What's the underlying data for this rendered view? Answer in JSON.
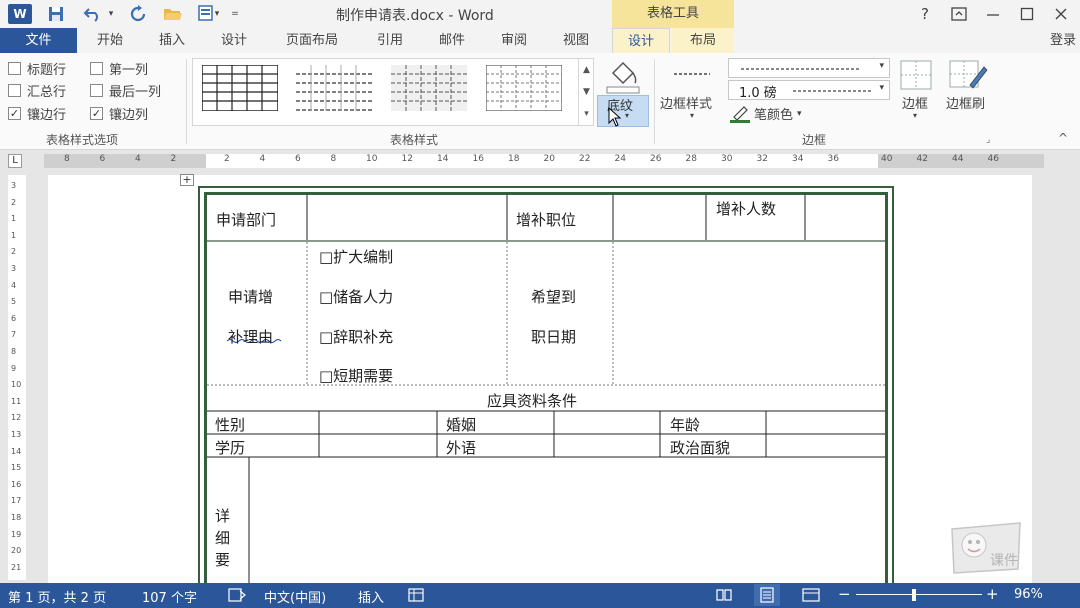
{
  "titlebar": {
    "app_icon": "W",
    "title": "制作申请表.docx - Word",
    "tools_header": "表格工具",
    "help": "?",
    "icons": [
      "word-icon",
      "save-icon",
      "undo-icon",
      "redo-icon",
      "open-folder-icon",
      "print-preview-icon",
      "customize-icon",
      "help-icon",
      "ribbon-display-icon",
      "minimize-icon",
      "maximize-icon",
      "close-icon"
    ]
  },
  "tabs": {
    "file": "文件",
    "items": [
      "开始",
      "插入",
      "设计",
      "页面布局",
      "引用",
      "邮件",
      "审阅",
      "视图"
    ],
    "tools_design": "设计",
    "tools_layout": "布局",
    "login": "登录"
  },
  "ribbon": {
    "options": {
      "header_row": "标题行",
      "first_column": "第一列",
      "total_row": "汇总行",
      "last_column": "最后一列",
      "banded_rows": "镶边行",
      "banded_columns": "镶边列",
      "checked": {
        "header_row": false,
        "first_column": false,
        "total_row": false,
        "last_column": false,
        "banded_rows": true,
        "banded_columns": true
      },
      "group_label": "表格样式选项"
    },
    "styles": {
      "group_label": "表格样式"
    },
    "shading": {
      "label": "底纹"
    },
    "borders": {
      "border_styles": "边框样式",
      "weight": "1.0 磅",
      "pen_color": "笔颜色",
      "borders": "边框",
      "border_painter": "边框刷",
      "group_label": "边框"
    }
  },
  "ruler": {
    "corner": "L",
    "ticks": [
      "8",
      "6",
      "4",
      "2",
      "2",
      "4",
      "6",
      "8",
      "10",
      "12",
      "14",
      "16",
      "18",
      "20",
      "22",
      "24",
      "26",
      "28",
      "30",
      "32",
      "34",
      "36",
      "40",
      "42",
      "44",
      "46"
    ],
    "vticks": [
      "3",
      "2",
      "1",
      "1",
      "2",
      "3",
      "4",
      "5",
      "6",
      "7",
      "8",
      "9",
      "10",
      "11",
      "12",
      "13",
      "14",
      "15",
      "16",
      "17",
      "18",
      "19",
      "20",
      "21"
    ]
  },
  "form": {
    "dept": "申请部门",
    "position": "增补职位",
    "headcount": "增补人数",
    "reason_1": "申请增",
    "reason_2": "补理由",
    "options": [
      "□扩大编制",
      "□储备人力",
      "□辞职补充",
      "□短期需要"
    ],
    "date_1": "希望到",
    "date_2": "职日期",
    "requirements": "应具资料条件",
    "gender": "性别",
    "marriage": "婚姻",
    "age": "年龄",
    "education": "学历",
    "language": "外语",
    "political": "政治面貌",
    "detail": "详细要"
  },
  "status": {
    "page": "第 1 页，共 2 页",
    "words": "107 个字",
    "language": "中文(中国)",
    "mode": "插入",
    "zoom": "96%"
  },
  "watermark": "课件"
}
